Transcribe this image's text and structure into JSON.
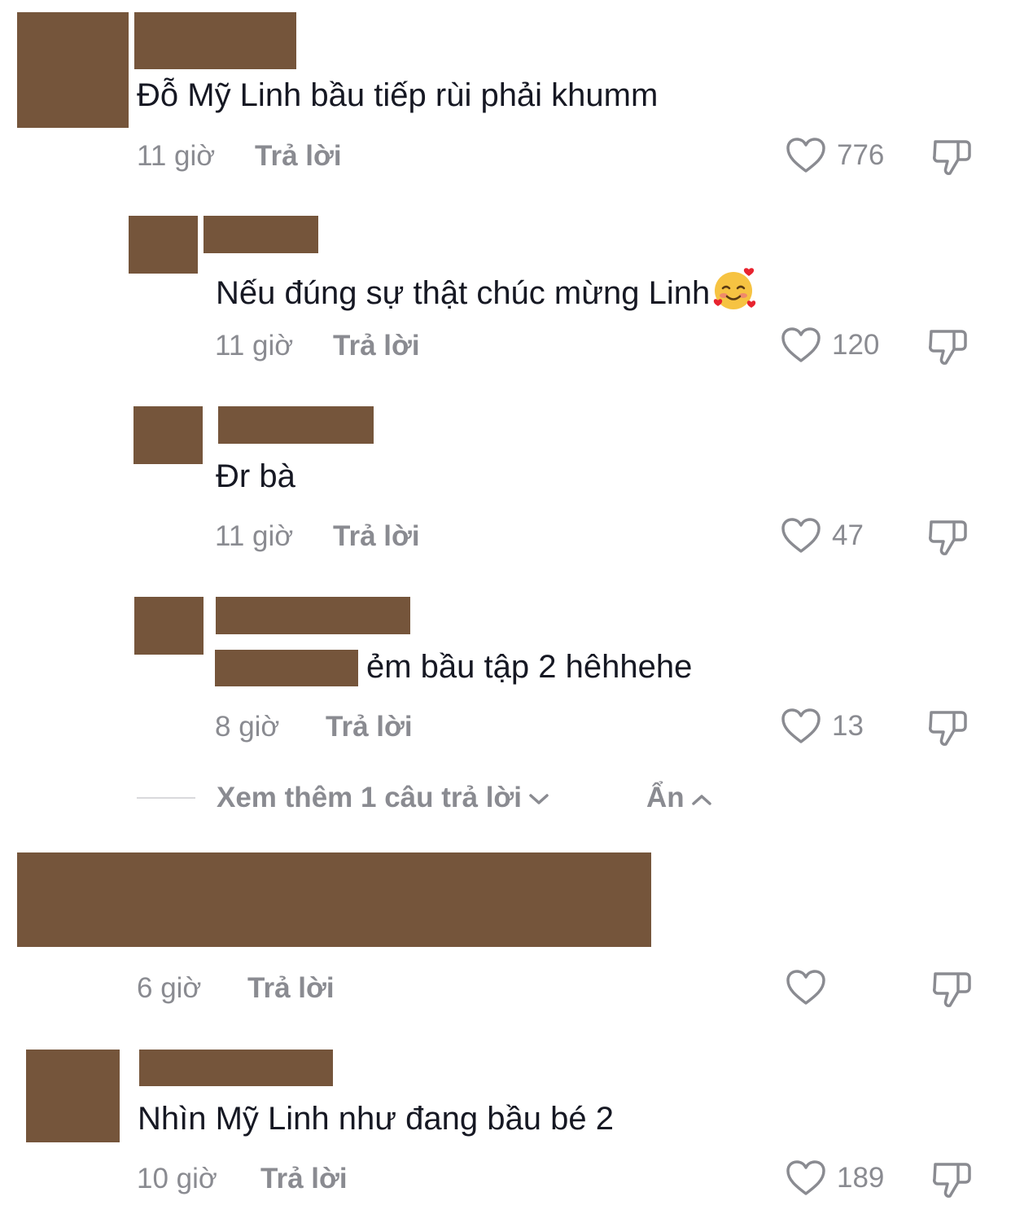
{
  "comments": [
    {
      "text": "Đỗ Mỹ Linh bầu tiếp rùi phải khumm",
      "time": "11 giờ",
      "reply_label": "Trả lời",
      "likes": "776"
    },
    {
      "text": "Nếu đúng sự thật chúc mừng Linh",
      "emoji": "smiling-face-with-hearts",
      "time": "11 giờ",
      "reply_label": "Trả lời",
      "likes": "120"
    },
    {
      "text": "Đr bà",
      "time": "11 giờ",
      "reply_label": "Trả lời",
      "likes": "47"
    },
    {
      "text": "ẻm bầu tập 2 hêhhehe",
      "time": "8 giờ",
      "reply_label": "Trả lời",
      "likes": "13"
    },
    {
      "time": "6 giờ",
      "reply_label": "Trả lời",
      "likes": ""
    },
    {
      "text": "Nhìn Mỹ Linh như đang bầu bé 2",
      "time": "10 giờ",
      "reply_label": "Trả lời",
      "likes": "189"
    }
  ],
  "replies_controls": {
    "view_more": "Xem thêm 1 câu trả lời",
    "hide": "Ẩn"
  },
  "colors": {
    "redaction": "#75553b",
    "muted_text": "#8a8b91",
    "main_text": "#161823"
  }
}
